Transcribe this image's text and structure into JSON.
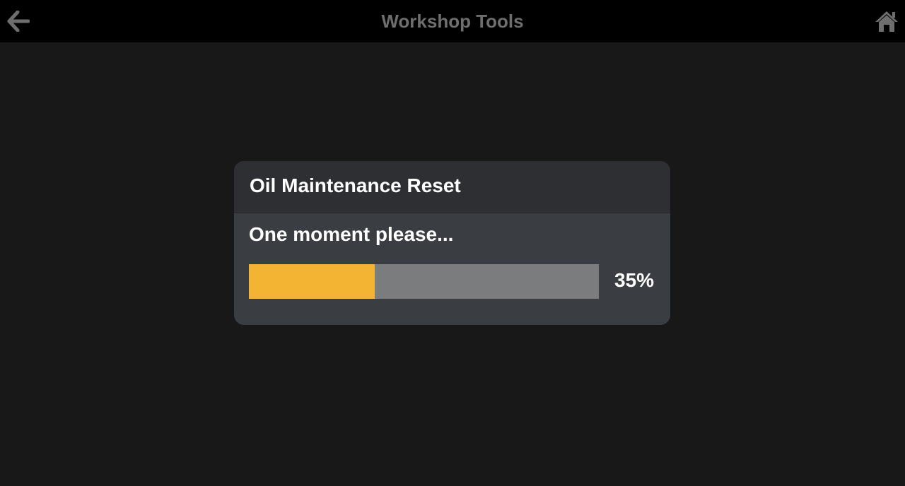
{
  "header": {
    "title": "Workshop Tools",
    "back_icon": "arrow-left-icon",
    "home_icon": "home-icon"
  },
  "dialog": {
    "title": "Oil Maintenance Reset",
    "message": "One moment please...",
    "progress_label": "35%",
    "progress_value": 0.36
  },
  "colors": {
    "topbar_bg": "#000000",
    "page_bg": "#181818",
    "dialog_header_bg": "#2d2f32",
    "dialog_body_bg": "#3a3e42",
    "progress_fill": "#f4b433",
    "progress_track": "#7b7c7e",
    "icon_color": "#6e6e6e"
  }
}
